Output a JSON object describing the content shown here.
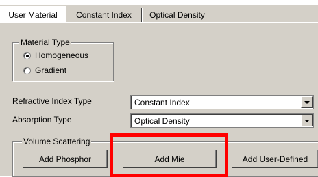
{
  "tabs": [
    {
      "label": "User Material",
      "active": true
    },
    {
      "label": "Constant Index",
      "active": false
    },
    {
      "label": "Optical Density",
      "active": false
    }
  ],
  "material_type": {
    "title": "Material Type",
    "options": [
      {
        "label": "Homogeneous",
        "selected": true
      },
      {
        "label": "Gradient",
        "selected": false
      }
    ]
  },
  "refractive_index": {
    "label": "Refractive Index Type",
    "value": "Constant Index"
  },
  "absorption": {
    "label": "Absorption Type",
    "value": "Optical Density"
  },
  "volume_scattering": {
    "title": "Volume Scattering",
    "buttons": [
      "Add Phosphor",
      "Add Mie",
      "Add User-Defined"
    ]
  },
  "colors": {
    "highlight": "#ff0000",
    "dialog": "#d4d0c8"
  }
}
